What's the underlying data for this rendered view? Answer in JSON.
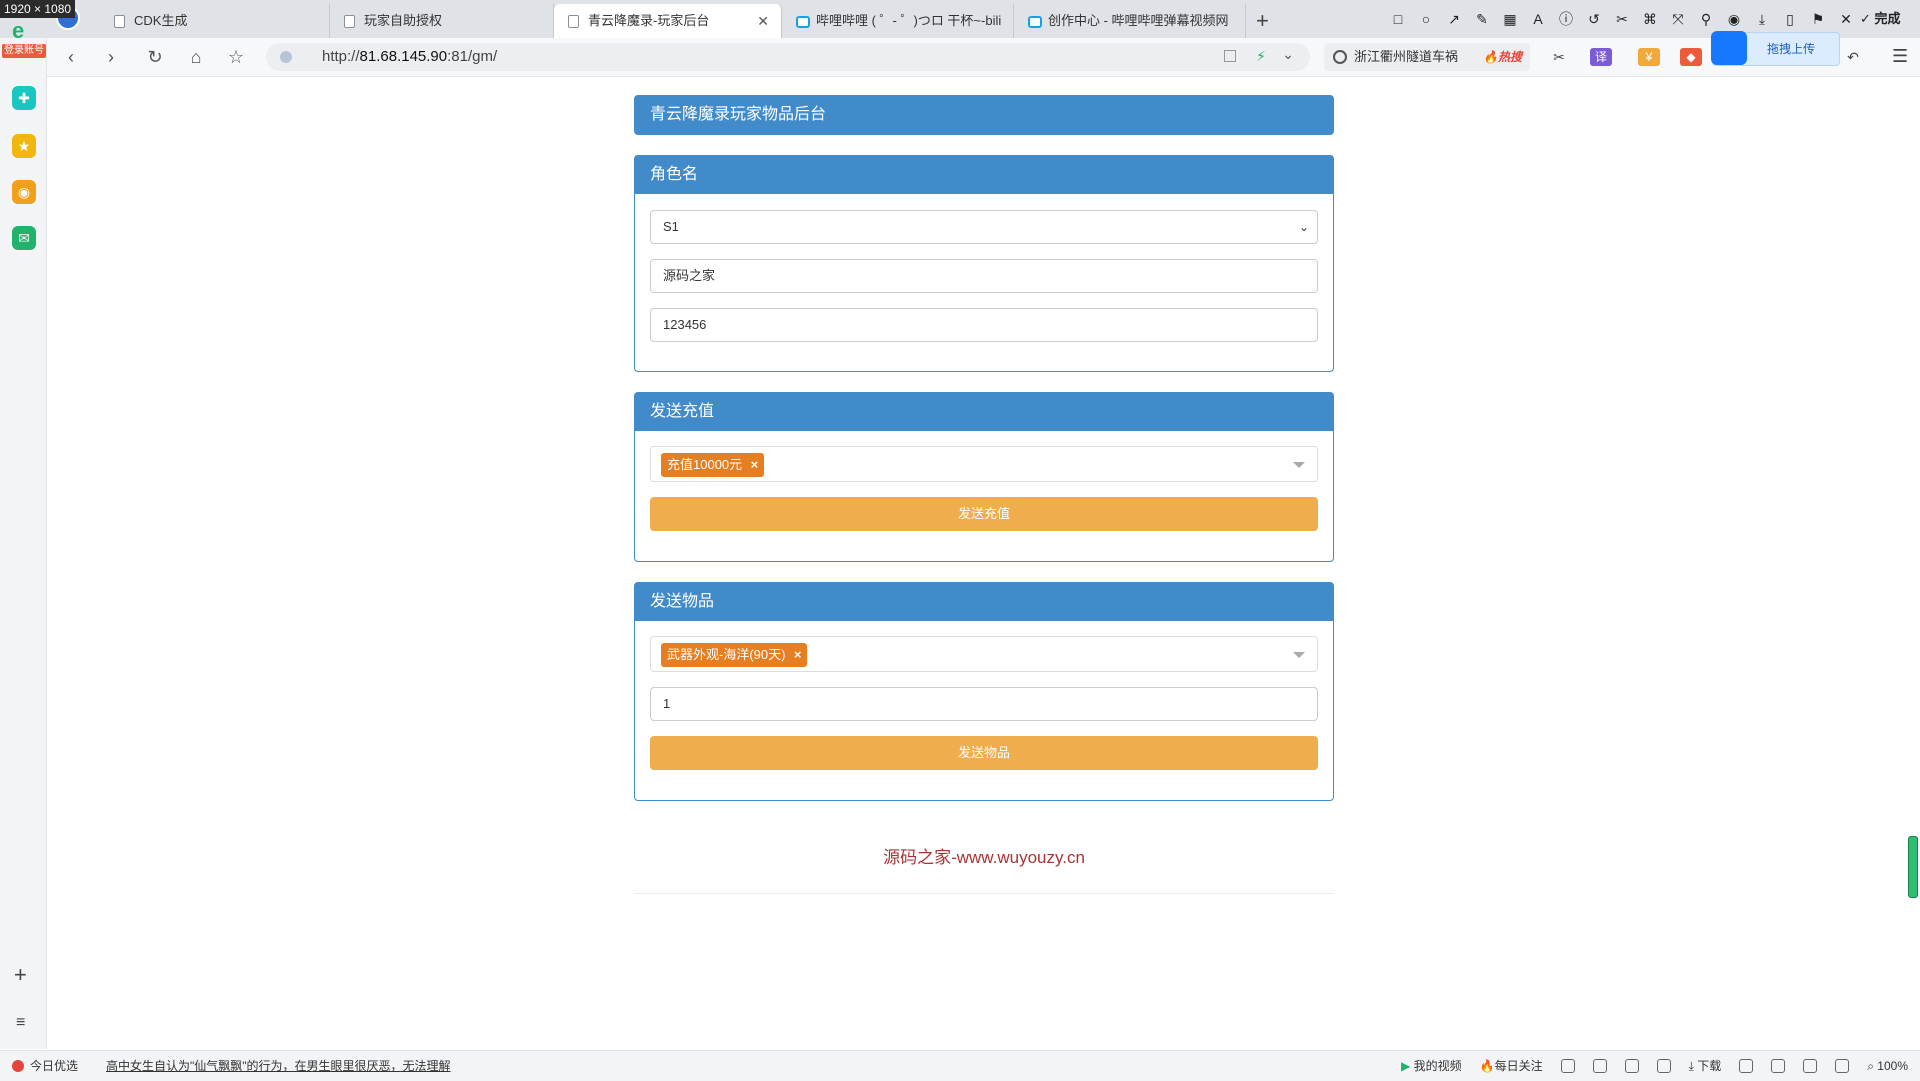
{
  "overlay": {
    "size_label": "1920 × 1080"
  },
  "tabs": [
    {
      "label": "CDK生成",
      "icon": "page-icon"
    },
    {
      "label": "玩家自助授权",
      "icon": "page-icon"
    },
    {
      "label": "青云降魔录-玩家后台",
      "icon": "page-icon",
      "active": true
    },
    {
      "label": "哔哩哔哩 ( ゜- ゜)つロ 干杯~-bili",
      "icon": "bilibili-icon"
    },
    {
      "label": "创作中心 - 哔哩哔哩弹幕视频网",
      "icon": "bilibili-icon"
    }
  ],
  "toolbar": {
    "done_label": "✓ 完成"
  },
  "address": {
    "url_prefix": "http://",
    "url_host": "81.68.145.90",
    "url_rest": ":81/gm/"
  },
  "search": {
    "text": "浙江衢州隧道车祸",
    "hot_label": "🔥热搜"
  },
  "extensions": {
    "translate_label": "译"
  },
  "upload": {
    "label": "拖拽上传"
  },
  "sidebar": {
    "login_label": "登录账号"
  },
  "page": {
    "title": "青云降魔录玩家物品后台",
    "role_panel": {
      "heading": "角色名",
      "server_value": "S1",
      "name_value": "源码之家",
      "password_value": "123456"
    },
    "recharge_panel": {
      "heading": "发送充值",
      "selected_chip": "充值10000元",
      "button_label": "发送充值"
    },
    "item_panel": {
      "heading": "发送物品",
      "selected_chip": "武器外观-海洋(90天)",
      "quantity_value": "1",
      "button_label": "发送物品"
    },
    "footer_text": "源码之家-www.wuyouzy.cn"
  },
  "statusbar": {
    "today_label": "今日优选",
    "news_text": "高中女生自认为\"仙气飘飘\"的行为，在男生眼里很厌恶，无法理解",
    "my_video": "我的视频",
    "daily_follow": "每日关注",
    "download": "下载",
    "zoom": "100%"
  }
}
